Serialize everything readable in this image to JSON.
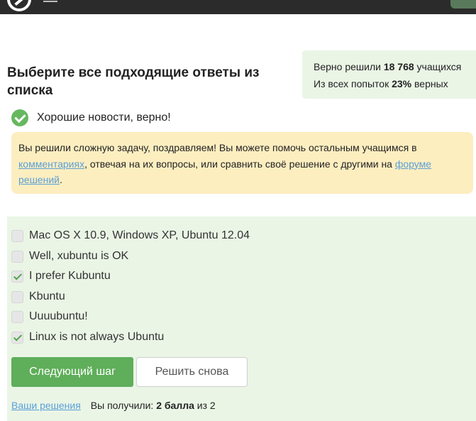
{
  "header": {
    "logo_icon": "stepik-logo-icon",
    "menu_icon": "hamburger-menu-icon"
  },
  "task": {
    "title": "Выберите все подходящие ответы из списка"
  },
  "stats": {
    "line1_prefix": "Верно решили",
    "solved_count": "18 768",
    "line1_suffix": "учащихся",
    "line2_prefix": "Из всех попыток",
    "percent": "23%",
    "line2_suffix": "верных"
  },
  "verdict": {
    "icon": "check-circle-icon",
    "text": "Хорошие новости, верно!"
  },
  "note": {
    "text_before": "Вы решили сложную задачу, поздравляем! Вы можете помочь остальным учащимся в",
    "link_comments": "комментариях",
    "text_middle": ", отвечая на их вопросы, или сравнить своё решение с другими на",
    "link_forum": "форуме решений",
    "text_after": "."
  },
  "options": [
    {
      "label": "Mac OS X 10.9, Windows XP, Ubuntu 12.04",
      "checked": false
    },
    {
      "label": "Well, xubuntu is OK",
      "checked": false
    },
    {
      "label": "I prefer Kubuntu",
      "checked": true
    },
    {
      "label": "Kbuntu",
      "checked": false
    },
    {
      "label": "Uuuubuntu!",
      "checked": false
    },
    {
      "label": "Linux is not always Ubuntu",
      "checked": true
    }
  ],
  "actions": {
    "next_label": "Следующий шаг",
    "retry_label": "Решить снова"
  },
  "footer": {
    "solutions_link": "Ваши решения",
    "score_prefix": "Вы получили:",
    "score_value": "2 балла",
    "score_suffix": "из 2"
  },
  "colors": {
    "success": "#66b85f",
    "panel_bg": "#eaf5e6",
    "note_bg": "#fdeec0",
    "link": "#5aa0d8"
  }
}
